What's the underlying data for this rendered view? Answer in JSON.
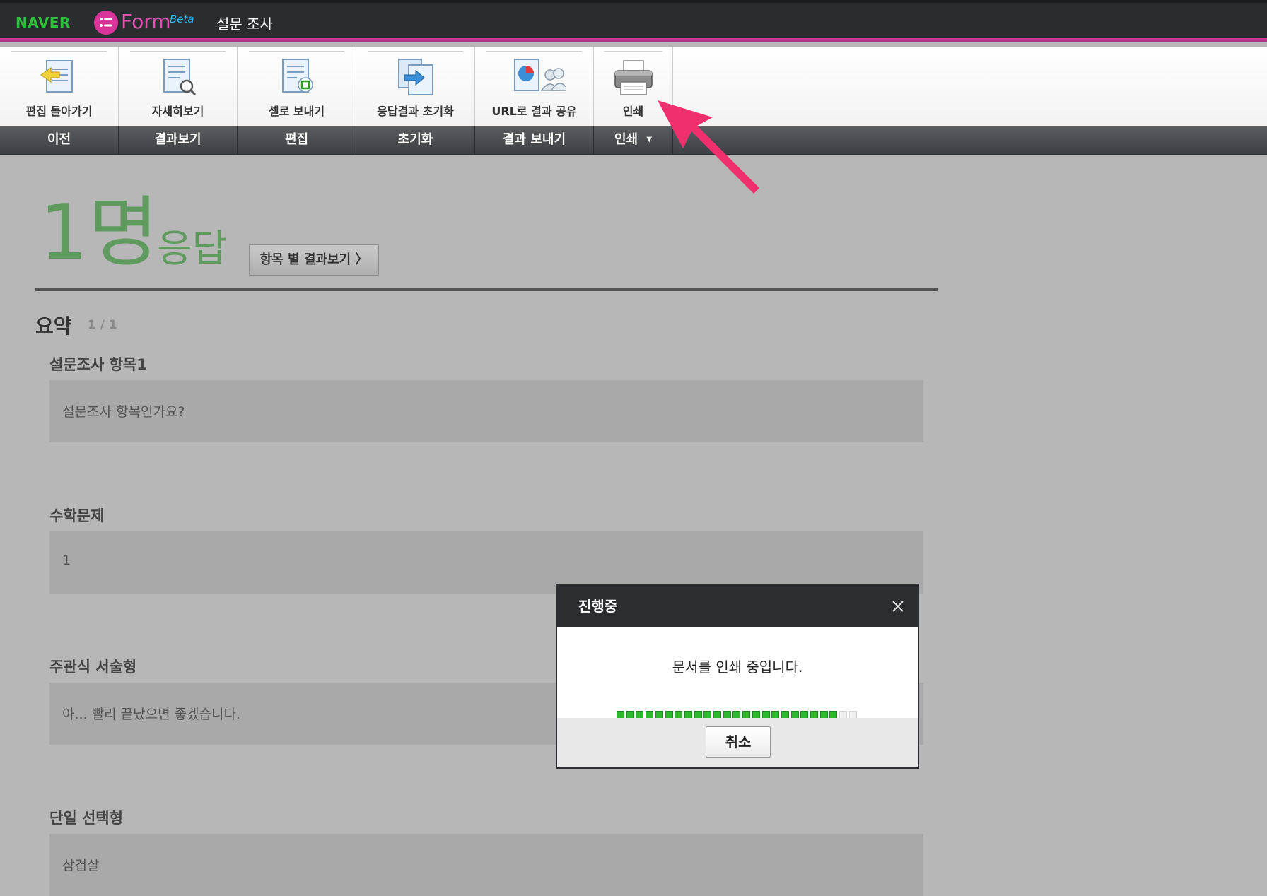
{
  "header": {
    "brand": "NAVER",
    "product": "Form",
    "beta": "Beta",
    "page_name": "설문 조사"
  },
  "toolbar": {
    "tools": [
      {
        "label": "편집 돌아가기",
        "icon": "back-to-edit-icon"
      },
      {
        "label": "자세히보기",
        "icon": "detail-view-icon"
      },
      {
        "label": "셀로 보내기",
        "icon": "send-to-cell-icon"
      },
      {
        "label": "응답결과 초기화",
        "icon": "reset-results-icon"
      },
      {
        "label": "URL로 결과 공유",
        "icon": "share-url-icon"
      },
      {
        "label": "인쇄",
        "icon": "printer-icon"
      }
    ],
    "categories": [
      "이전",
      "결과보기",
      "편집",
      "초기화",
      "결과 보내기",
      "인쇄"
    ]
  },
  "summary": {
    "count_number": "1명",
    "count_label": "응답",
    "item_result_button": "항목 별 결과보기 〉",
    "title": "요약",
    "page_indicator": "1 / 1",
    "questions": [
      {
        "title": "설문조사 항목1",
        "answer": "설문조사 항목인가요?"
      },
      {
        "title": "수학문제",
        "answer": "1"
      },
      {
        "title": "주관식 서술형",
        "answer": "아... 빨리 끝났으면 좋겠습니다."
      },
      {
        "title": "단일 선택형",
        "answer": "삼겹살"
      }
    ]
  },
  "dialog": {
    "title": "진행중",
    "message": "문서를 인쇄 중입니다.",
    "progress": 0.92,
    "cancel_label": "취소"
  },
  "colors": {
    "accent_pink": "#d13a9a",
    "naver_green": "#2fc13e",
    "progress_green": "#2db82d",
    "arrow": "#f0306e"
  }
}
